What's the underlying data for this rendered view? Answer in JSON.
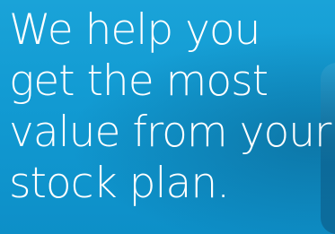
{
  "hero": {
    "headline_lines": [
      "We help you",
      "get the most",
      "value from your",
      "stock plan."
    ],
    "colors": {
      "background": "#129bd3",
      "text": "#ffffff"
    }
  }
}
